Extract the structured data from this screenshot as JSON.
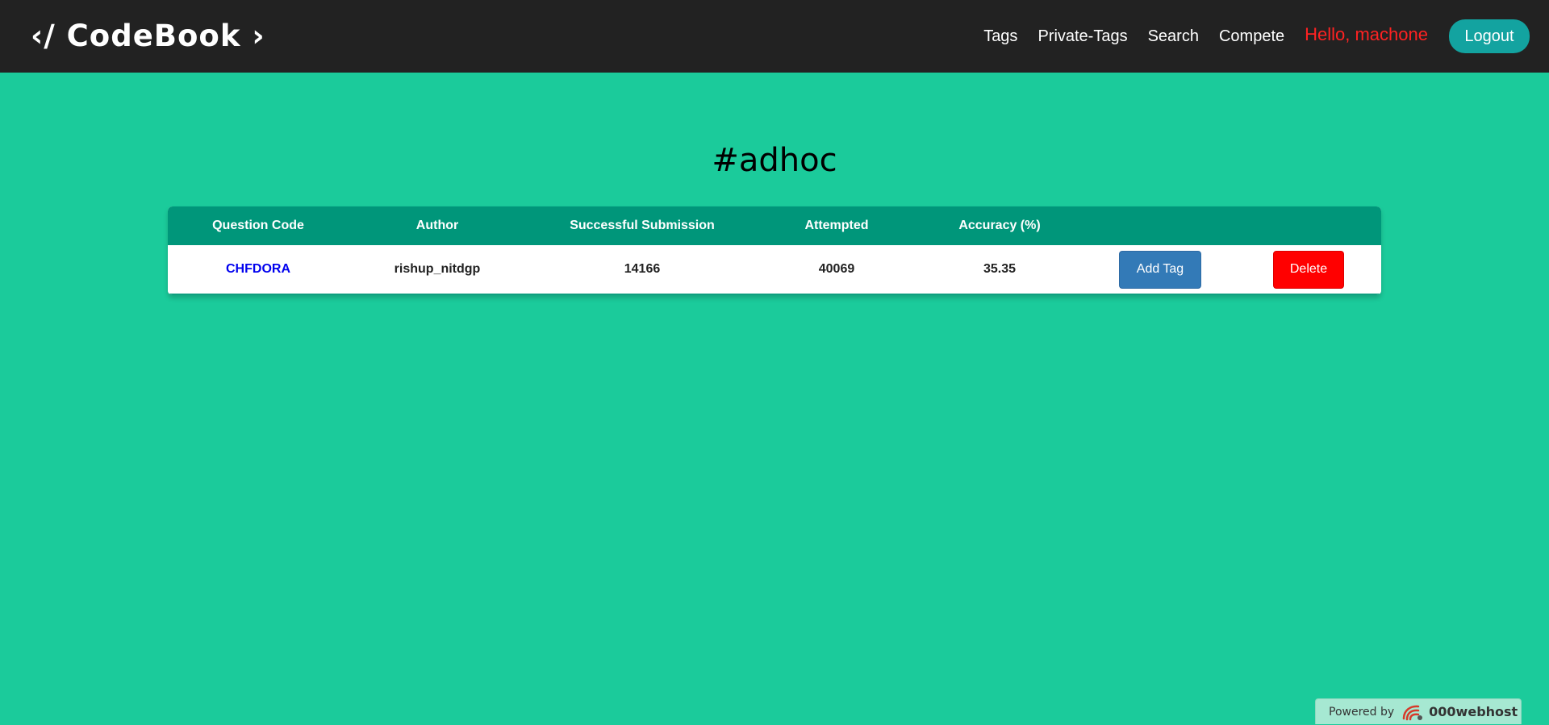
{
  "navbar": {
    "brand": "‹/ CodeBook ›",
    "links": [
      "Tags",
      "Private-Tags",
      "Search",
      "Compete"
    ],
    "greeting": "Hello, machone",
    "logout_label": "Logout"
  },
  "page": {
    "title": "#adhoc"
  },
  "table": {
    "columns": [
      "Question Code",
      "Author",
      "Successful Submission",
      "Attempted",
      "Accuracy (%)",
      "",
      ""
    ],
    "rows": [
      {
        "question_code": "CHFDORA",
        "author": "rishup_nitdgp",
        "successful_submission": "14166",
        "attempted": "40069",
        "accuracy": "35.35",
        "add_tag_label": "Add Tag",
        "delete_label": "Delete"
      }
    ]
  },
  "footer_badge": {
    "powered_by": "Powered by",
    "host_name": "000webhost",
    "icon": "webhost-logo-icon"
  },
  "colors": {
    "page_background": "#1bcb9b",
    "navbar_background": "#222222",
    "table_header": "#00967a",
    "greeting": "#ff2222",
    "logout_button": "#13a3a0",
    "add_tag_button": "#337ab7",
    "delete_button": "#ff0000",
    "question_link": "#0000ee"
  }
}
